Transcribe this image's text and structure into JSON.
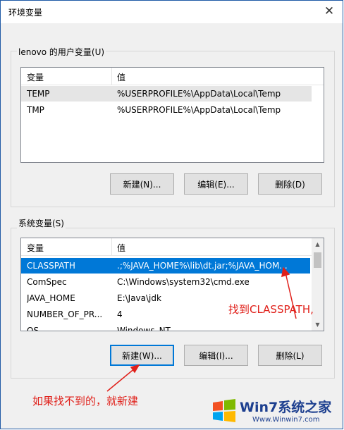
{
  "window": {
    "title": "环境变量",
    "close_glyph": "✕"
  },
  "user_section": {
    "label": "lenovo 的用户变量(U)",
    "columns": [
      "变量",
      "值"
    ],
    "rows": [
      {
        "name": "TEMP",
        "value": "%USERPROFILE%\\AppData\\Local\\Temp",
        "selected": true
      },
      {
        "name": "TMP",
        "value": "%USERPROFILE%\\AppData\\Local\\Temp",
        "selected": false
      }
    ],
    "buttons": {
      "new": "新建(N)...",
      "edit": "编辑(E)...",
      "delete": "删除(D)"
    }
  },
  "system_section": {
    "label": "系统变量(S)",
    "columns": [
      "变量",
      "值"
    ],
    "rows": [
      {
        "name": "CLASSPATH",
        "value": ".;%JAVA_HOME%\\lib\\dt.jar;%JAVA_HOM...",
        "selected": true
      },
      {
        "name": "ComSpec",
        "value": "C:\\Windows\\system32\\cmd.exe",
        "selected": false
      },
      {
        "name": "JAVA_HOME",
        "value": "E:\\Java\\jdk",
        "selected": false
      },
      {
        "name": "NUMBER_OF_PR...",
        "value": "4",
        "selected": false
      },
      {
        "name": "OS",
        "value": "Windows_NT",
        "selected": false
      }
    ],
    "buttons": {
      "new": "新建(W)...",
      "edit": "编辑(I)...",
      "delete": "删除(L)"
    }
  },
  "annotations": {
    "find": "找到CLASSPATH,",
    "create": "如果找不到的，就新建"
  },
  "watermark": {
    "brand": "Win7系统之家",
    "url": "Www.Winwin7.com"
  },
  "colors": {
    "selection": "#0078d7",
    "annotation": "#e0201a",
    "border": "#1f5aa6"
  }
}
